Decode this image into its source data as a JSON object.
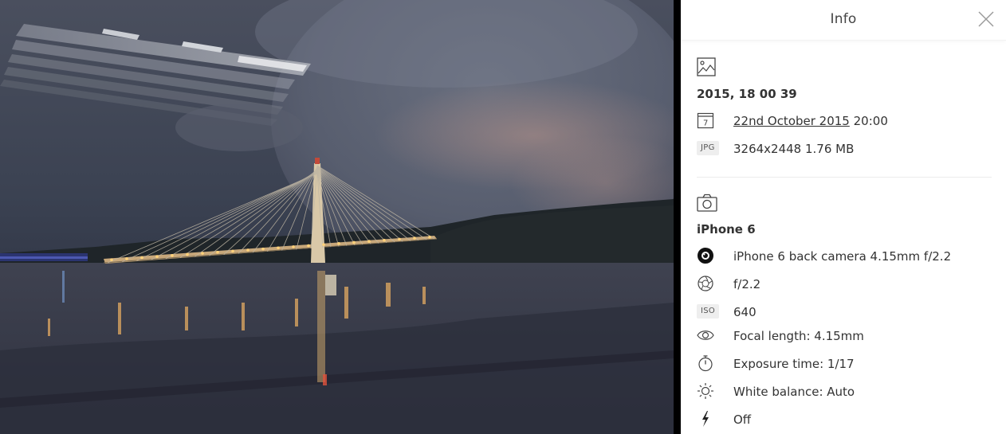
{
  "panel": {
    "title": "Info",
    "file_section": {
      "name": "2015, 18 00 39",
      "date_link": "22nd October 2015",
      "time": "20:00",
      "format_badge": "JPG",
      "dimensions_size": "3264x2448 1.76 MB"
    },
    "camera_section": {
      "model": "iPhone 6",
      "lens": "iPhone 6 back camera 4.15mm f/2.2",
      "aperture": "f/2.2",
      "iso_badge": "ISO",
      "iso_value": "640",
      "focal_length": "Focal length: 4.15mm",
      "exposure_time": "Exposure time: 1/17",
      "white_balance": "White balance: Auto",
      "flash": "Off"
    }
  },
  "icons": {
    "close": "close-icon",
    "image": "image-icon",
    "calendar": "calendar-icon",
    "camera": "camera-icon",
    "lens": "lens-icon",
    "aperture": "aperture-icon",
    "eye": "eye-icon",
    "timer": "timer-icon",
    "sun": "sun-icon",
    "flash": "flash-icon"
  },
  "colors": {
    "panel_bg": "#ffffff",
    "text": "#333333",
    "badge_bg": "#eeeeee",
    "separator": "#ececec"
  }
}
